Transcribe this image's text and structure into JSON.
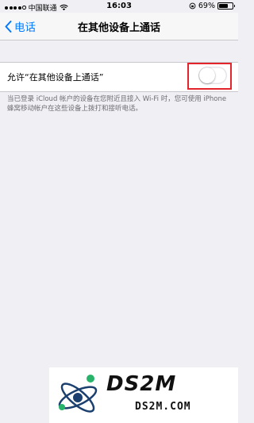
{
  "status_bar": {
    "carrier": "中国联通",
    "time": "16:03",
    "battery_percent": "69%",
    "battery_level": 0.69,
    "signal_bars": 4
  },
  "nav": {
    "back_label": "电话",
    "title": "在其他设备上通话"
  },
  "setting": {
    "label": "允许“在其他设备上通话”",
    "toggle_on": false
  },
  "footnote": "当已登录 iCloud 帐户的设备在您附近且接入 Wi-Fi 时，您可使用 iPhone 蜂窝移动帐户在这些设备上拨打和接听电话。",
  "watermark": {
    "main": "DS2M",
    "sub": "DS2M.COM"
  },
  "colors": {
    "accent": "#007aff",
    "highlight": "#e3252b",
    "background": "#efeff4"
  }
}
